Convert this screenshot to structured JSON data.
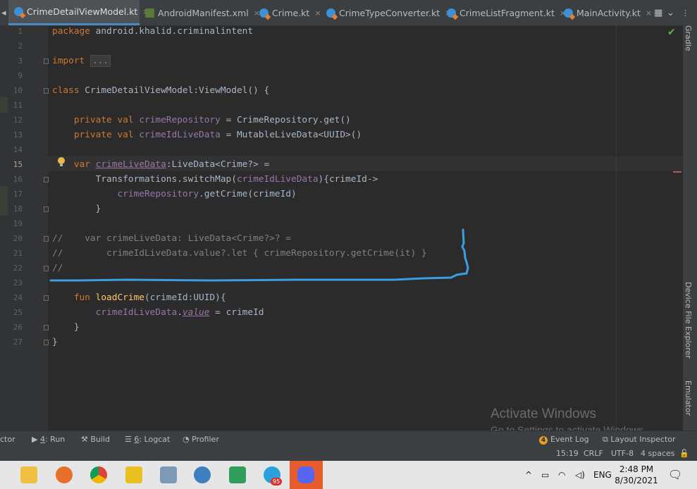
{
  "tabs": [
    {
      "label": "CrimeDetailViewModel.kt",
      "icon": "kotlin-file-icon",
      "active": true
    },
    {
      "label": "AndroidManifest.xml",
      "icon": "xml-file-icon"
    },
    {
      "label": "Crime.kt",
      "icon": "kotlin-file-icon"
    },
    {
      "label": "CrimeTypeConverter.kt",
      "icon": "kotlin-file-icon"
    },
    {
      "label": "CrimeListFragment.kt",
      "icon": "kotlin-file-icon"
    },
    {
      "label": "MainActivity.kt",
      "icon": "kotlin-file-icon"
    }
  ],
  "tab_close_glyph": "×",
  "editor": {
    "line_numbers": [
      "1",
      "2",
      "3",
      "9",
      "10",
      "11",
      "12",
      "13",
      "14",
      "15",
      "16",
      "17",
      "18",
      "19",
      "20",
      "21",
      "22",
      "23",
      "24",
      "25",
      "26",
      "27"
    ],
    "current_line": "15",
    "code": {
      "l1_kw": "package",
      "l1_rest": " android.khalid.criminalintent",
      "l3_kw": "import",
      "l3_fold": "...",
      "l10_kw": "class",
      "l10_rest": " CrimeDetailViewModel:ViewModel() {",
      "l12_kw": "    private val ",
      "l12_prop": "crimeRepository",
      "l12_rest": " = CrimeRepository.get()",
      "l13_kw": "    private val ",
      "l13_prop": "crimeIdLiveData",
      "l13_rest": " = MutableLiveData<UUID>()",
      "l15_kw": "    var ",
      "l15_prop": "crimeLiveData",
      "l15_rest": ":LiveData<Crime?> =",
      "l16_a": "        Transformations.switchMap(",
      "l16_prop": "crimeIdLiveData",
      "l16_b": "){crimeId->",
      "l17_a": "            ",
      "l17_prop": "crimeRepository",
      "l17_b": ".getCrime(crimeId)",
      "l18": "        }",
      "l20": "//    var crimeLiveData: LiveData<Crime?>? =",
      "l21": "//        crimeIdLiveData.value?.let { crimeRepository.getCrime(it) }",
      "l22": "//",
      "l24_kw": "    fun ",
      "l24_fn": "loadCrime",
      "l24_rest": "(crimeId:UUID){",
      "l25_prop": "        crimeIdLiveData",
      "l25_dot": ".",
      "l25_val": "value",
      "l25_rest": " = crimeId",
      "l26": "    }",
      "l27": "}"
    }
  },
  "right_panel": {
    "gradle": "Gradle",
    "device_file_explorer": "Device File Explorer",
    "emulator": "Emulator"
  },
  "watermark": {
    "line1": "Activate Windows",
    "line2": "Go to Settings to activate Windows."
  },
  "tool_windows": {
    "inspector_partial": "ctor",
    "run_num": "4",
    "run_label": ": Run",
    "build": "Build",
    "logcat_num": "6",
    "logcat_label": ": Logcat",
    "profiler": "Profiler",
    "event_log_badge": "4",
    "event_log": "Event Log",
    "layout_inspector": "Layout Inspector"
  },
  "status": {
    "position": "15:19",
    "line_sep": "CRLF",
    "encoding": "UTF-8",
    "indent": "4 spaces"
  },
  "taskbar": {
    "apps": [
      "file-explorer-icon",
      "firefox-icon",
      "chrome-icon",
      "pdf-reader-icon",
      "paint-icon",
      "android-studio-icon",
      "notepad-icon",
      "telegram-icon",
      "discord-icon"
    ],
    "telegram_badge": "95",
    "language": "ENG",
    "time": "2:48 PM",
    "date": "8/30/2021"
  },
  "colors": {
    "annotation_line": "#3a9ee0",
    "keyword": "#cc7832",
    "property": "#9876aa",
    "function": "#ffc66d",
    "comment": "#808080"
  }
}
